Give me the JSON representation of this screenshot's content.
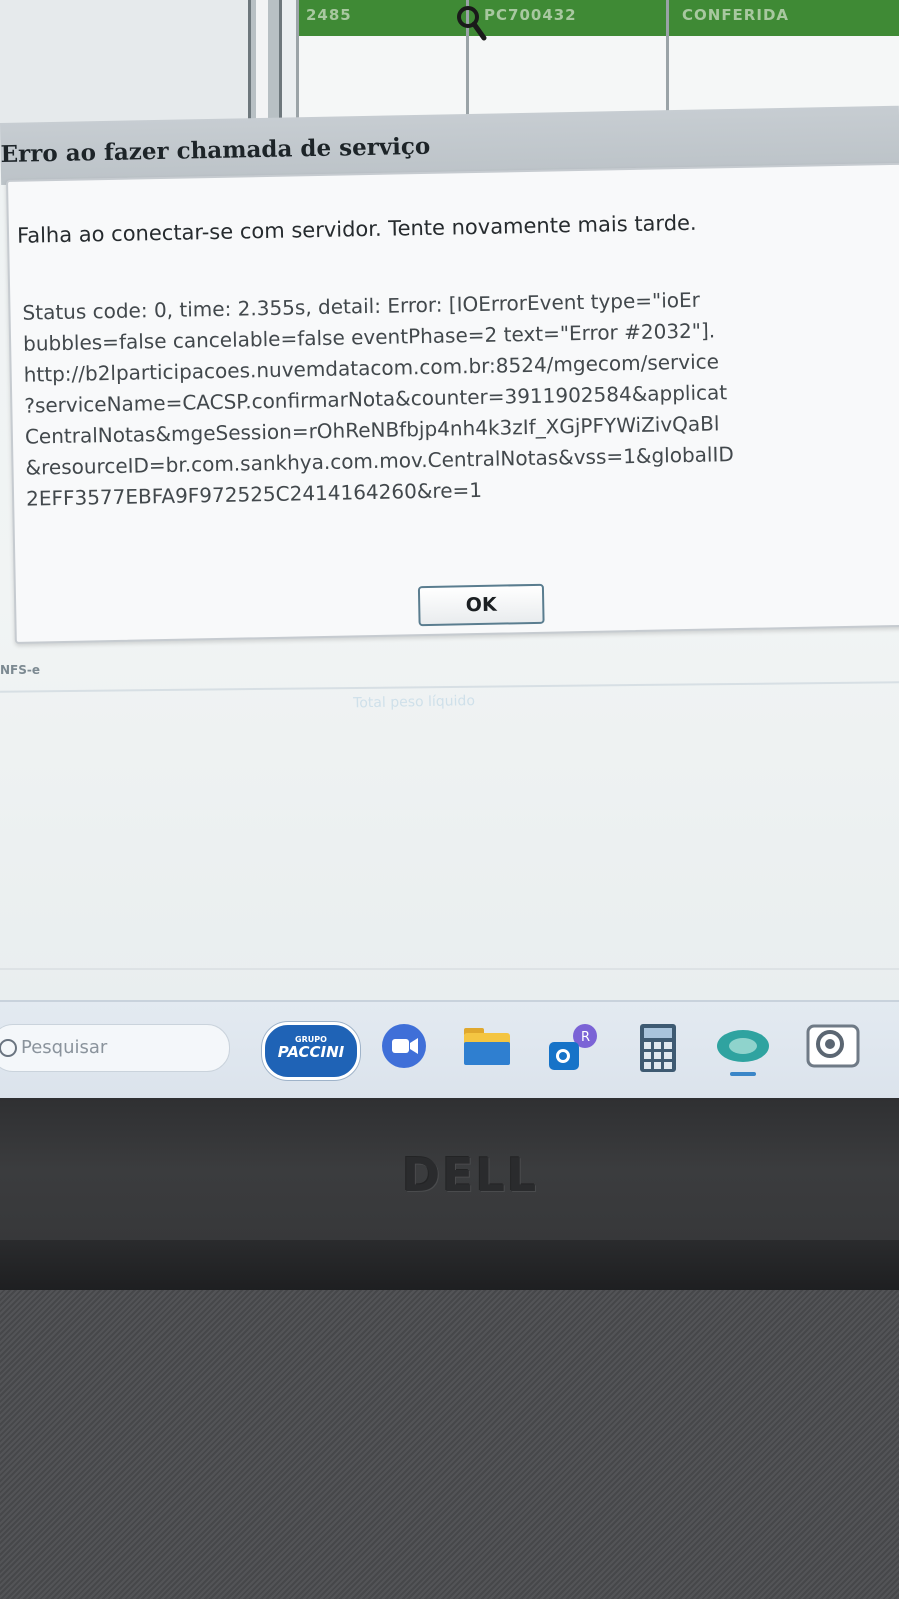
{
  "background_app": {
    "grid_cells": [
      "2485",
      "PC700432",
      "CONFERIDA"
    ],
    "below_dialog_tab": "NFS-e"
  },
  "dialog": {
    "title": "Erro ao fazer chamada de serviço",
    "message": "Falha ao conectar-se com servidor. Tente novamente mais tarde.",
    "detail_lines": [
      "Status code: 0, time: 2.355s, detail: Error: [IOErrorEvent type=\"ioEr",
      "bubbles=false cancelable=false eventPhase=2 text=\"Error #2032\"].",
      "http://b2lparticipacoes.nuvemdatacom.com.br:8524/mgecom/service",
      "?serviceName=CACSP.confirmarNota&counter=3911902584&applicat",
      "CentralNotas&mgeSession=rOhReNBfbjp4nh4k3zIf_XGjPFYWiZivQaBl",
      "&resourceID=br.com.sankhya.com.mov.CentralNotas&vss=1&globalID",
      "2EFF3577EBFA9F972525C2414164260&re=1"
    ],
    "ok_label": "OK",
    "ghost_text": "Total peso líquido"
  },
  "taskbar": {
    "search_placeholder": "Pesquisar",
    "logo_small": "GRUPO",
    "logo_text": "PACCINI",
    "icons": [
      "paccini-logo-icon",
      "meet-icon",
      "file-explorer-icon",
      "outlook-teams-icon",
      "calculator-icon",
      "browser-globe-icon",
      "app-icon"
    ]
  },
  "hardware": {
    "brand": "DELL"
  }
}
